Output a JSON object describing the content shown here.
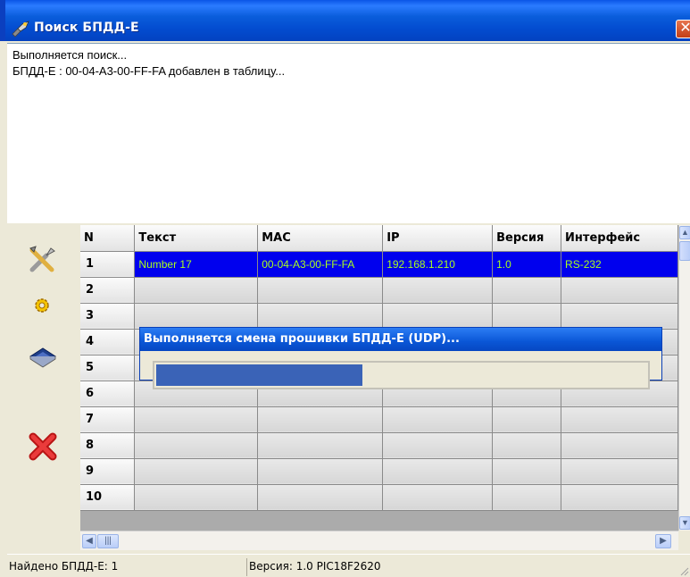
{
  "window": {
    "title": "Поиск БПДД-Е",
    "close_label": "✕"
  },
  "log": {
    "lines": [
      "Выполняется поиск...",
      "БПДД-Е : 00-04-A3-00-FF-FA добавлен в таблицу..."
    ]
  },
  "toolbar": {
    "settings_icon": "tools-icon",
    "firmware_icon": "gear-icon",
    "chip_icon": "chip-icon",
    "delete_icon": "close-icon"
  },
  "grid": {
    "columns": [
      "N",
      "Текст",
      "MAC",
      "IP",
      "Версия",
      "Интерфейс"
    ],
    "rows": [
      {
        "n": "1",
        "text": "Number 17",
        "mac": "00-04-A3-00-FF-FA",
        "ip": "192.168.1.210",
        "version": "1.0",
        "iface": "RS-232",
        "selected": true
      },
      {
        "n": "2",
        "text": "",
        "mac": "",
        "ip": "",
        "version": "",
        "iface": ""
      },
      {
        "n": "3",
        "text": "",
        "mac": "",
        "ip": "",
        "version": "",
        "iface": ""
      },
      {
        "n": "4",
        "text": "",
        "mac": "",
        "ip": "",
        "version": "",
        "iface": ""
      },
      {
        "n": "5",
        "text": "",
        "mac": "",
        "ip": "",
        "version": "",
        "iface": ""
      },
      {
        "n": "6",
        "text": "",
        "mac": "",
        "ip": "",
        "version": "",
        "iface": ""
      },
      {
        "n": "7",
        "text": "",
        "mac": "",
        "ip": "",
        "version": "",
        "iface": ""
      },
      {
        "n": "8",
        "text": "",
        "mac": "",
        "ip": "",
        "version": "",
        "iface": ""
      },
      {
        "n": "9",
        "text": "",
        "mac": "",
        "ip": "",
        "version": "",
        "iface": ""
      },
      {
        "n": "10",
        "text": "",
        "mac": "",
        "ip": "",
        "version": "",
        "iface": ""
      }
    ]
  },
  "progress_dialog": {
    "title": "Выполняется смена прошивки БПДД-Е (UDP)...",
    "progress_fraction": 0.42
  },
  "statusbar": {
    "found": "Найдено БПДД-Е: 1",
    "version": "Версия: 1.0   PIC18F2620"
  },
  "colors": {
    "selection_bg": "#0000ee",
    "selection_text": "#a8ff1e",
    "titlebar": "#0a5ddb",
    "progress_fill": "#3a63b7"
  }
}
